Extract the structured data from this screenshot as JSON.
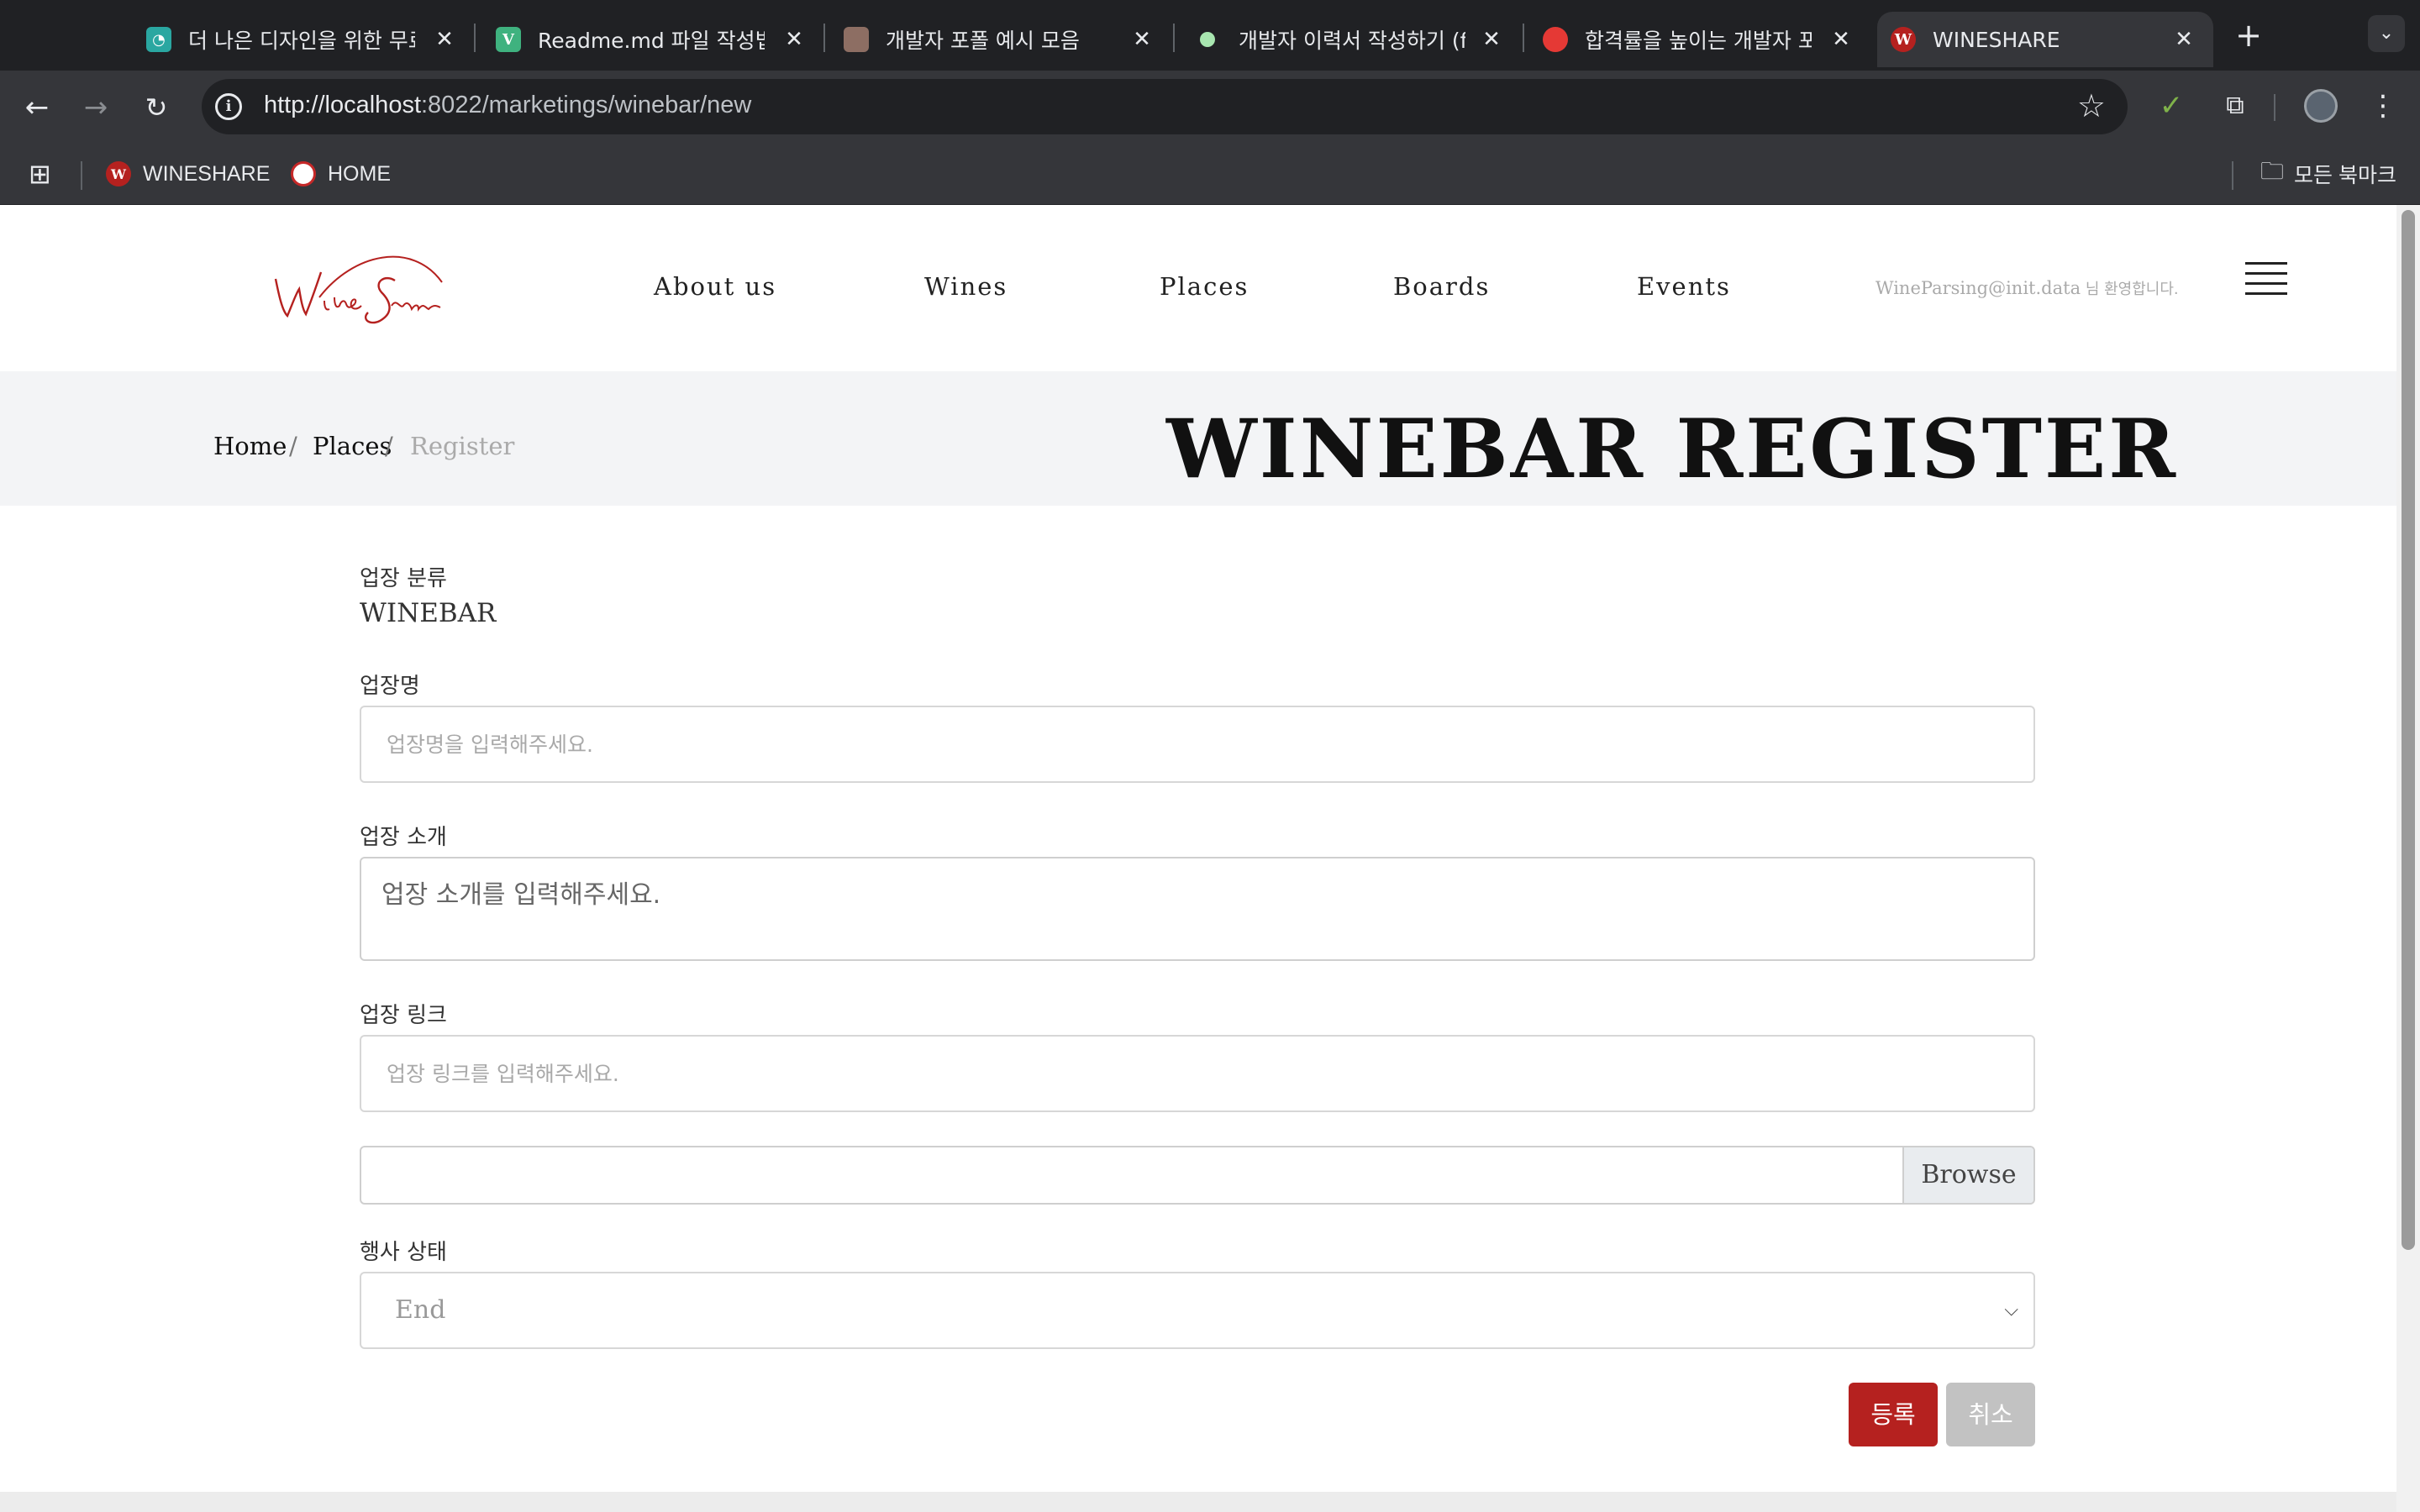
{
  "browser": {
    "tabs": [
      {
        "title": "더 나은 디자인을 위한 무료 템",
        "favicon_color": "#2aa7a1",
        "favicon_char": "◔"
      },
      {
        "title": "Readme.md 파일 작성법",
        "favicon_color": "#3fb27f",
        "favicon_char": "V"
      },
      {
        "title": "개발자 포폴 예시 모음",
        "favicon_color": "#8d6e63",
        "favicon_char": ""
      },
      {
        "title": "개발자 이력서 작성하기 (feat",
        "favicon_color": "#a8e6b0",
        "favicon_char": ""
      },
      {
        "title": "합격률을 높이는 개발자 포트",
        "favicon_color": "#e53935",
        "favicon_char": ""
      },
      {
        "title": "WINESHARE",
        "favicon_color": "#b5211f",
        "favicon_char": "W"
      }
    ],
    "url_host": "http://localhost",
    "url_path": ":8022/marketings/winebar/new",
    "bookmarks": [
      {
        "label": "WINESHARE",
        "color": "#b5211f",
        "char": "W"
      },
      {
        "label": "HOME",
        "color": "#ffffff",
        "char": ""
      }
    ],
    "all_bookmarks": "모든 북마크"
  },
  "site": {
    "logo_text": "Wine Share",
    "nav": [
      "About us",
      "Wines",
      "Places",
      "Boards",
      "Events"
    ],
    "welcome_user": "WineParsing@init.data",
    "welcome_suffix": " 님 환영합니다.",
    "accent_color": "#b5211f"
  },
  "hero": {
    "breadcrumbs": [
      "Home",
      "Places",
      "Register"
    ],
    "title": "WINEBAR REGISTER"
  },
  "form": {
    "category_label": "업장 분류",
    "category_value": "WINEBAR",
    "name_label": "업장명",
    "name_placeholder": "업장명을 입력해주세요.",
    "intro_label": "업장 소개",
    "intro_placeholder": "업장 소개를 입력해주세요.",
    "link_label": "업장 링크",
    "link_placeholder": "업장 링크를 입력해주세요.",
    "browse_label": "Browse",
    "status_label": "행사 상태",
    "status_value": "End",
    "submit_label": "등록",
    "cancel_label": "취소"
  }
}
